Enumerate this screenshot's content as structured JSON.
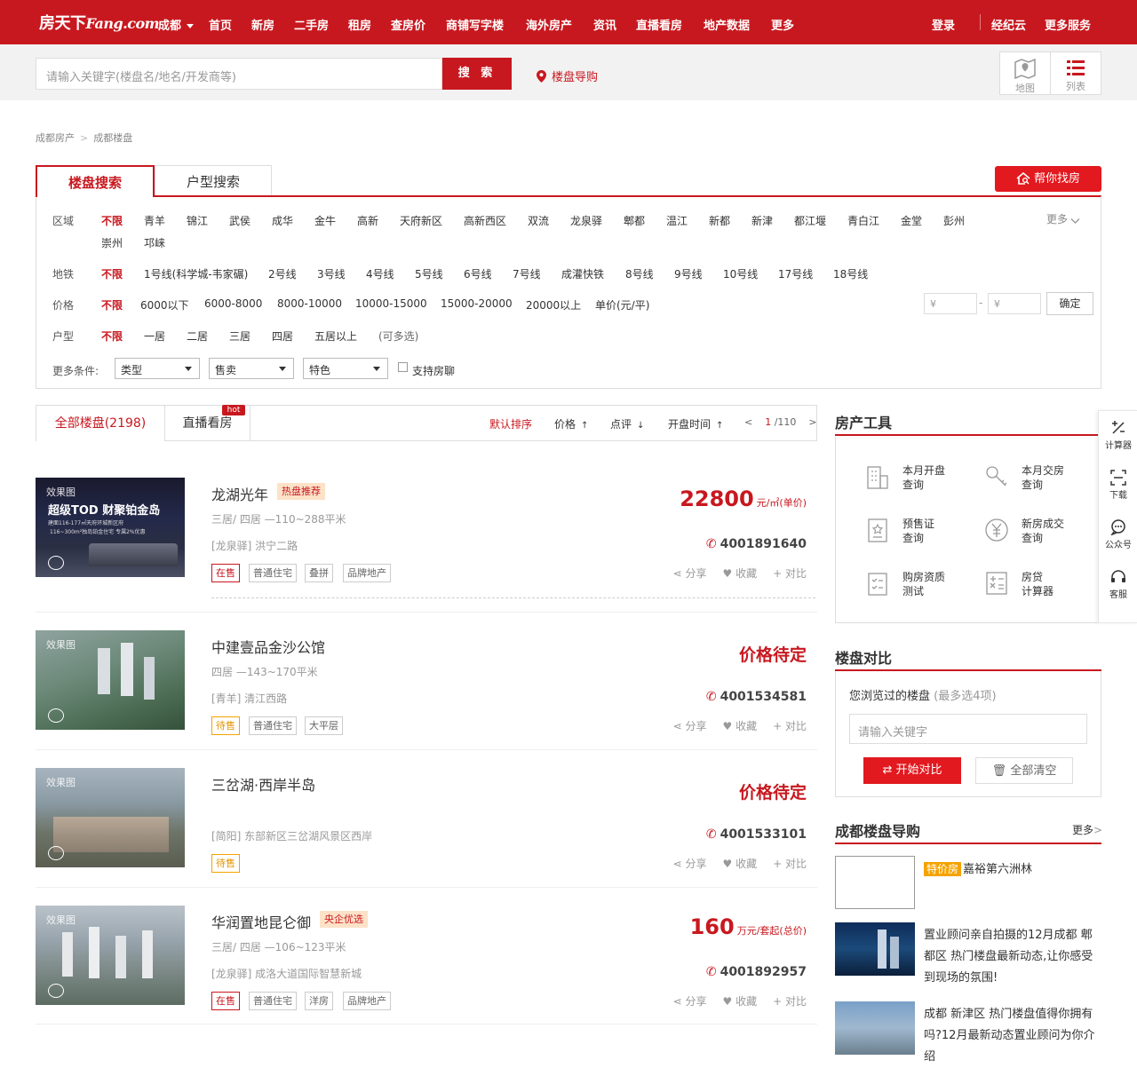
{
  "header": {
    "logo_cn": "房天下",
    "logo_en": "Fang.com",
    "city": "成都",
    "nav": [
      "首页",
      "新房",
      "二手房",
      "租房",
      "查房价",
      "商铺写字楼",
      "海外房产",
      "资讯",
      "直播看房",
      "地产数据",
      "更多"
    ],
    "right_nav": [
      "登录",
      "经纪云",
      "更多服务"
    ]
  },
  "search": {
    "placeholder": "请输入关键字(楼盘名/地名/开发商等)",
    "button": "搜 索",
    "guide": "楼盘导购",
    "view_map": "地图",
    "view_list": "列表"
  },
  "breadcrumb": [
    "成都房产",
    "成都楼盘"
  ],
  "filter": {
    "tabs": [
      "楼盘搜索",
      "户型搜索"
    ],
    "help_button": "帮你找房",
    "region_label": "区域",
    "region": [
      "不限",
      "青羊",
      "锦江",
      "武侯",
      "成华",
      "金牛",
      "高新",
      "天府新区",
      "高新西区",
      "双流",
      "龙泉驿",
      "郫都",
      "温江",
      "新都",
      "新津",
      "都江堰",
      "青白江",
      "金堂",
      "彭州",
      "崇州",
      "邛崃"
    ],
    "more": "更多",
    "metro_label": "地铁",
    "metro": [
      "不限",
      "1号线(科学城-韦家碾)",
      "2号线",
      "3号线",
      "4号线",
      "5号线",
      "6号线",
      "7号线",
      "成灌快铁",
      "8号线",
      "9号线",
      "10号线",
      "17号线",
      "18号线"
    ],
    "price_label": "价格",
    "price": [
      "不限",
      "6000以下",
      "6000-8000",
      "8000-10000",
      "10000-15000",
      "15000-20000",
      "20000以上",
      "单价(元/平)"
    ],
    "price_min": "¥",
    "price_max": "¥",
    "price_dash": "-",
    "price_ok": "确定",
    "layout_label": "户型",
    "layout": [
      "不限",
      "一居",
      "二居",
      "三居",
      "四居",
      "五居以上",
      "(可多选)"
    ],
    "more_label": "更多条件:",
    "selects": [
      "类型",
      "售卖",
      "特色"
    ],
    "checkbox": "支持房聊"
  },
  "list_tabs": {
    "all": "全部楼盘(2198)",
    "live": "直播看房",
    "hot": "hot",
    "sort_default": "默认排序",
    "sort_price": "价格",
    "sort_review": "点评",
    "sort_open": "开盘时间",
    "page_prev": "<",
    "page_cur": "1",
    "page_total": "/110",
    "page_next": ">"
  },
  "listings": [
    {
      "name": "龙湖光年",
      "tag": "热盘推荐",
      "sub": "三居/ 四居 —110~288平米",
      "addr": "[龙泉驿] 洪宁二路",
      "pills": [
        "在售",
        "普通住宅",
        "叠拼",
        "品牌地产"
      ],
      "price": "22800",
      "unit": "元/㎡(单价)",
      "phone": "4001891640",
      "img_badge": "效果图",
      "ad_line1": "超级TOD 财聚铂金岛",
      "ad_line2": "建面116-177㎡天府环城新区府",
      "ad_line3": "116~300m²独岛铂金住宅 专属2%优惠"
    },
    {
      "name": "中建壹品金沙公馆",
      "tag": "",
      "sub": "四居 —143~170平米",
      "addr": "[青羊] 清江西路",
      "pills": [
        "待售",
        "普通住宅",
        "大平层"
      ],
      "price": "价格待定",
      "unit": "",
      "phone": "4001534581",
      "img_badge": "效果图"
    },
    {
      "name": "三岔湖·西岸半岛",
      "tag": "",
      "sub": "",
      "addr": "[简阳] 东部新区三岔湖风景区西岸",
      "pills": [
        "待售"
      ],
      "price": "价格待定",
      "unit": "",
      "phone": "4001533101",
      "img_badge": "效果图"
    },
    {
      "name": "华润置地昆仑御",
      "tag": "央企优选",
      "sub": "三居/ 四居 —106~123平米",
      "addr": "[龙泉驿] 成洛大道国际智慧新城",
      "pills": [
        "在售",
        "普通住宅",
        "洋房",
        "品牌地产"
      ],
      "price": "160",
      "unit": "万元/套起(总价)",
      "phone": "4001892957",
      "img_badge": "效果图"
    }
  ],
  "actions": {
    "share": "分享",
    "fav": "收藏",
    "compare": "对比"
  },
  "tools": {
    "title": "房产工具",
    "items": [
      [
        "本月开盘",
        "查询"
      ],
      [
        "本月交房",
        "查询"
      ],
      [
        "预售证",
        "查询"
      ],
      [
        "新房成交",
        "查询"
      ],
      [
        "购房资质",
        "测试"
      ],
      [
        "房贷",
        "计算器"
      ]
    ]
  },
  "compare": {
    "title": "楼盘对比",
    "viewed": "您浏览过的楼盘",
    "limit": "(最多选4项)",
    "placeholder": "请输入关键字",
    "start": "开始对比",
    "clear": "全部清空"
  },
  "guide_list": {
    "title": "成都楼盘导购",
    "more": "更多",
    "items": [
      {
        "tag": "特价房",
        "text": "嘉裕第六洲林"
      },
      {
        "tag": "",
        "text": "置业顾问亲自拍摄的12月成都 郫都区 热门楼盘最新动态,让你感受到现场的氛围!"
      },
      {
        "tag": "",
        "text": "成都 新津区 热门楼盘值得你拥有吗?12月最新动态置业顾问为你介绍"
      }
    ]
  },
  "floatbar": [
    "计算器",
    "下载",
    "公众号",
    "客服"
  ],
  "colors": {
    "brand": "#c8181f",
    "accent": "#e2191f",
    "orange": "#f4a300"
  }
}
